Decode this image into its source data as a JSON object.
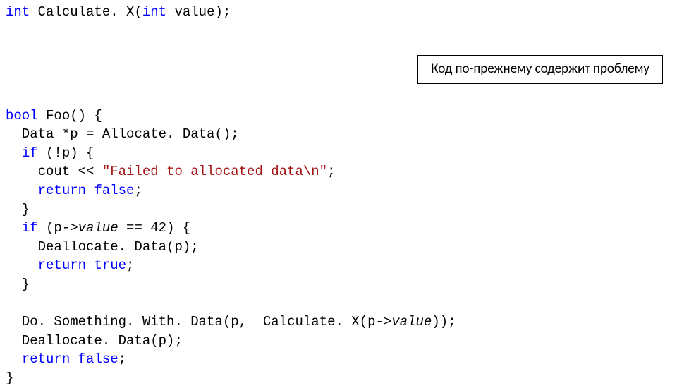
{
  "tokens": {
    "int1": "int",
    "calcx": " Calculate. X(",
    "int2": "int",
    "value": " value);",
    "bool": "bool",
    "foo_open": " Foo() {",
    "data_decl": "  Data *p = Allocate. Data();",
    "if1": "if",
    "if1_cond": " (!p) {",
    "cout_pre": "    cout << ",
    "str_literal": "\"Failed to allocated data\\n\"",
    "cout_post": ";",
    "return1": "return",
    "false1": "false",
    "semi1": ";",
    "brace_close1": "  }",
    "if2": "if",
    "if2_cond_a": " (p->",
    "value_ital1": "value",
    "if2_cond_b": " == 42) {",
    "dealloc1": "    Deallocate. Data(p);",
    "return2": "return",
    "true1": "true",
    "semi2": ";",
    "brace_close2": "  }",
    "dosomething_a": "  Do. Something. With. Data(p,  Calculate. X(p->",
    "value_ital2": "value",
    "dosomething_b": "));",
    "dealloc2": "  Deallocate. Data(p);",
    "return3": "return",
    "false2": "false",
    "semi3": ";",
    "brace_close3": "}"
  },
  "callout": "Код по-прежнему содержит проблему"
}
